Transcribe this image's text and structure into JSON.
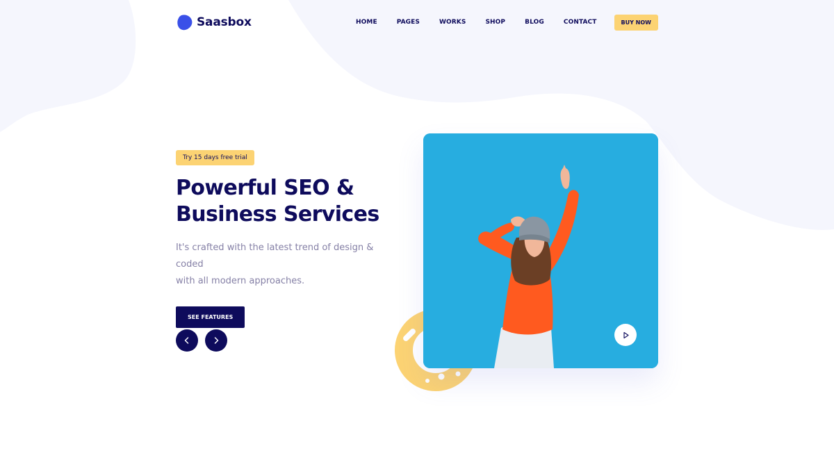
{
  "brand": {
    "name": "Saasbox",
    "logo_icon": "blob-logo-icon",
    "color": "#3a50e8"
  },
  "nav": {
    "items": [
      "HOME",
      "PAGES",
      "WORKS",
      "SHOP",
      "BLOG",
      "CONTACT"
    ],
    "cta": "BUY NOW"
  },
  "hero": {
    "badge": "Try 15 days free trial",
    "title_line1": "Powerful SEO &",
    "title_line2": "Business Services",
    "desc_line1": "It's crafted with the latest trend of design & coded",
    "desc_line2": "with all modern approaches.",
    "button": "SEE FEATURES"
  },
  "slider": {
    "prev_icon": "chevron-left-icon",
    "next_icon": "chevron-right-icon"
  },
  "media": {
    "image": "woman-dancing-photo",
    "play_icon": "play-icon"
  },
  "colors": {
    "navy": "#0e0b5c",
    "accent_yellow": "#fcd373",
    "blob_lavender": "#f5f6fd",
    "photo_blue": "#27ade0",
    "shirt_orange": "#ff5a1f"
  }
}
